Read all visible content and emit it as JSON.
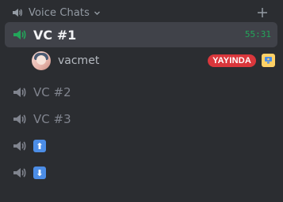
{
  "category": {
    "title": "Voice Chats",
    "icon": "speaker-icon",
    "chevron_icon": "chevron-down-icon",
    "add_icon": "plus-icon"
  },
  "channels": [
    {
      "name": "VC #1",
      "icon": "speaker-icon",
      "active": true,
      "timer": "55:31"
    },
    {
      "name": "VC #2",
      "icon": "speaker-icon",
      "active": false
    },
    {
      "name": "VC #3",
      "icon": "speaker-icon",
      "active": false
    },
    {
      "name": "⬆",
      "icon": "speaker-icon",
      "active": false,
      "emoji": "up-arrow-emoji"
    },
    {
      "name": "⬇",
      "icon": "speaker-icon",
      "active": false,
      "emoji": "down-arrow-emoji"
    }
  ],
  "member": {
    "username": "vacmet",
    "avatar": "avatar",
    "live_badge": "YAYINDA",
    "stream_icon": "screen-share-icon"
  },
  "colors": {
    "background": "#2b2d31",
    "active_row": "#404249",
    "muted_text": "#80848e",
    "live_red": "#da373c",
    "timer_green": "#23a55a"
  }
}
